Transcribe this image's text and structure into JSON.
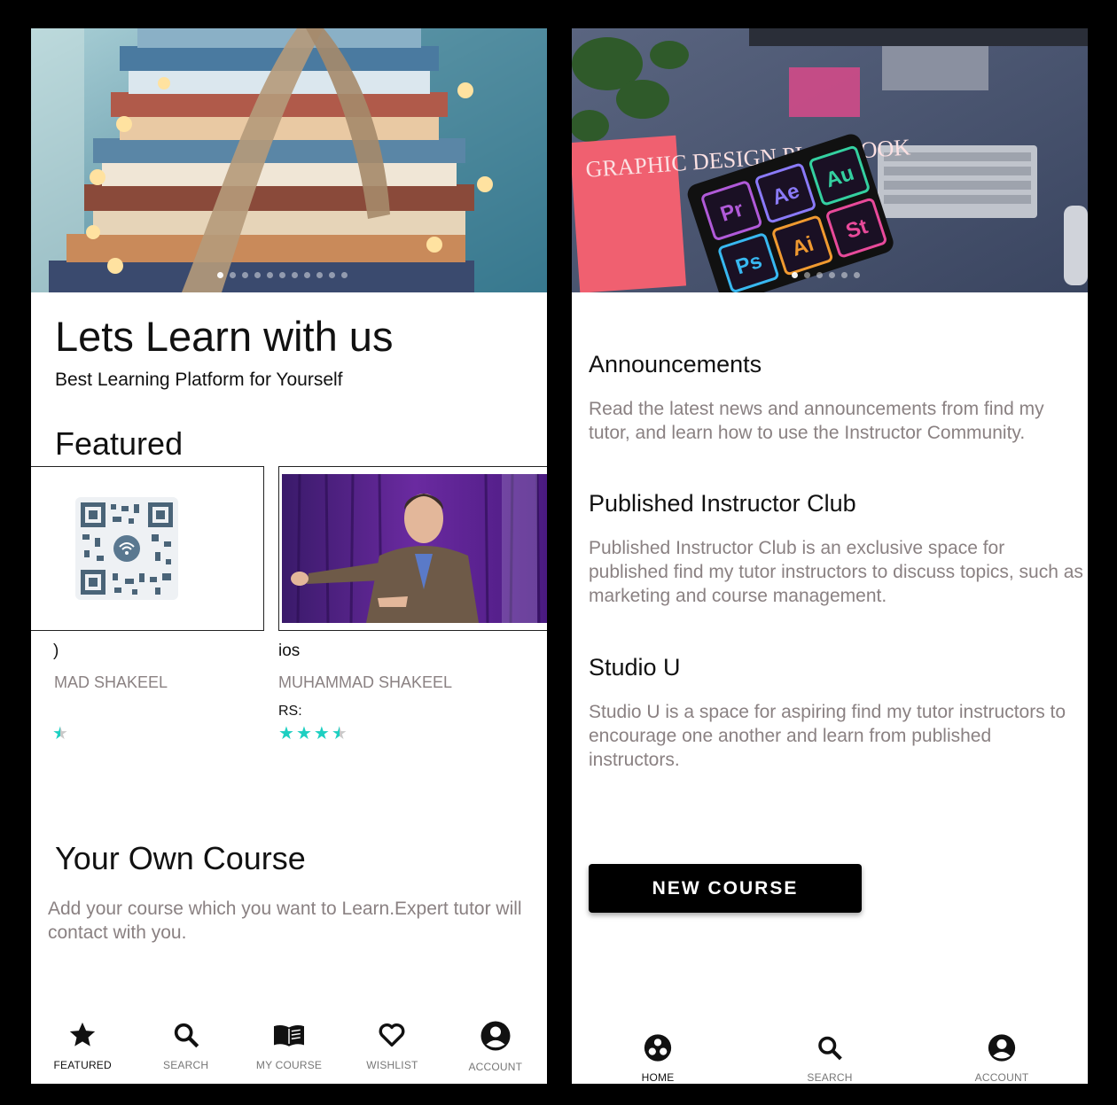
{
  "left": {
    "hero": {
      "dot_count": 11,
      "active_dot": 0
    },
    "title": "Lets Learn with us",
    "subtitle": "Best Learning Platform for Yourself",
    "featured_heading": "Featured",
    "courses": [
      {
        "title": ")",
        "author": "MAD SHAKEEL",
        "price_label": "",
        "rating": 0.5
      },
      {
        "title": "ios",
        "author": "MUHAMMAD SHAKEEL",
        "price_label": "RS:",
        "rating": 3.5
      }
    ],
    "own_course_heading": "Your Own Course",
    "own_course_text": "Add your course which you want to Learn.Expert tutor will contact with you.",
    "nav": [
      {
        "label": "FEATURED",
        "icon": "star-icon",
        "active": true
      },
      {
        "label": "SEARCH",
        "icon": "search-icon",
        "active": false
      },
      {
        "label": "MY COURSE",
        "icon": "book-icon",
        "active": false
      },
      {
        "label": "WISHLIST",
        "icon": "heart-icon",
        "active": false
      },
      {
        "label": "ACCOUNT",
        "icon": "account-icon",
        "active": false
      }
    ]
  },
  "right": {
    "hero": {
      "dot_count": 6,
      "active_dot": 0
    },
    "adobe_tiles": [
      "Pr",
      "Ae",
      "Au",
      "Ps",
      "Ai",
      "St"
    ],
    "notebook_text": "GRAPHIC DESIGN PLAY BOOK",
    "sections": [
      {
        "heading": "Announcements",
        "text": "Read the latest news and announcements from find my tutor, and learn how to use the Instructor Community."
      },
      {
        "heading": "Published Instructor Club",
        "text": "Published Instructor Club is an exclusive space for published find my tutor instructors to discuss topics, such as marketing and course management."
      },
      {
        "heading": "Studio U",
        "text": "Studio U is a space for aspiring find my tutor instructors to encourage one another and learn from published instructors."
      }
    ],
    "button_label": "NEW COURSE",
    "nav": [
      {
        "label": "HOME",
        "icon": "home-icon"
      },
      {
        "label": "SEARCH",
        "icon": "search-icon"
      },
      {
        "label": "ACCOUNT",
        "icon": "account-icon"
      }
    ]
  },
  "colors": {
    "accent": "#1dcfc1",
    "muted_text": "#8a8182",
    "button_bg": "#000000"
  }
}
